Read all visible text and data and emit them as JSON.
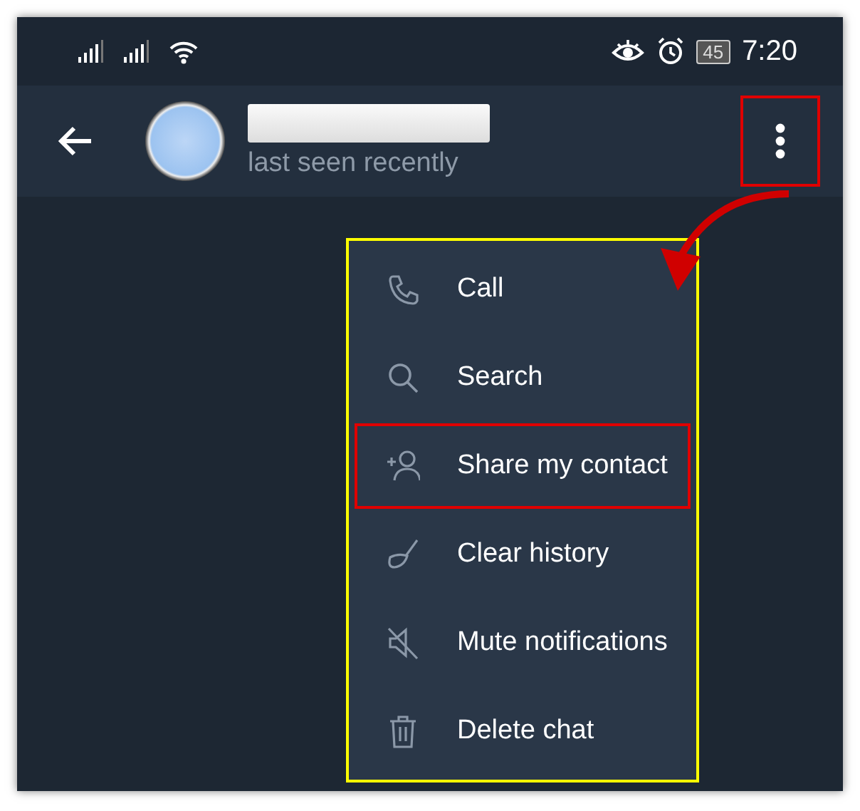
{
  "status_bar": {
    "battery": "45",
    "time": "7:20"
  },
  "header": {
    "subtitle": "last seen recently",
    "menu_button_highlighted": true
  },
  "menu": {
    "items": [
      {
        "label": "Call",
        "kind": "call",
        "highlighted": false
      },
      {
        "label": "Search",
        "kind": "search",
        "highlighted": false
      },
      {
        "label": "Share my contact",
        "kind": "add-person",
        "highlighted": true
      },
      {
        "label": "Clear history",
        "kind": "broom",
        "highlighted": false
      },
      {
        "label": "Mute notifications",
        "kind": "mute",
        "highlighted": false
      },
      {
        "label": "Delete chat",
        "kind": "trash",
        "highlighted": false
      }
    ]
  }
}
